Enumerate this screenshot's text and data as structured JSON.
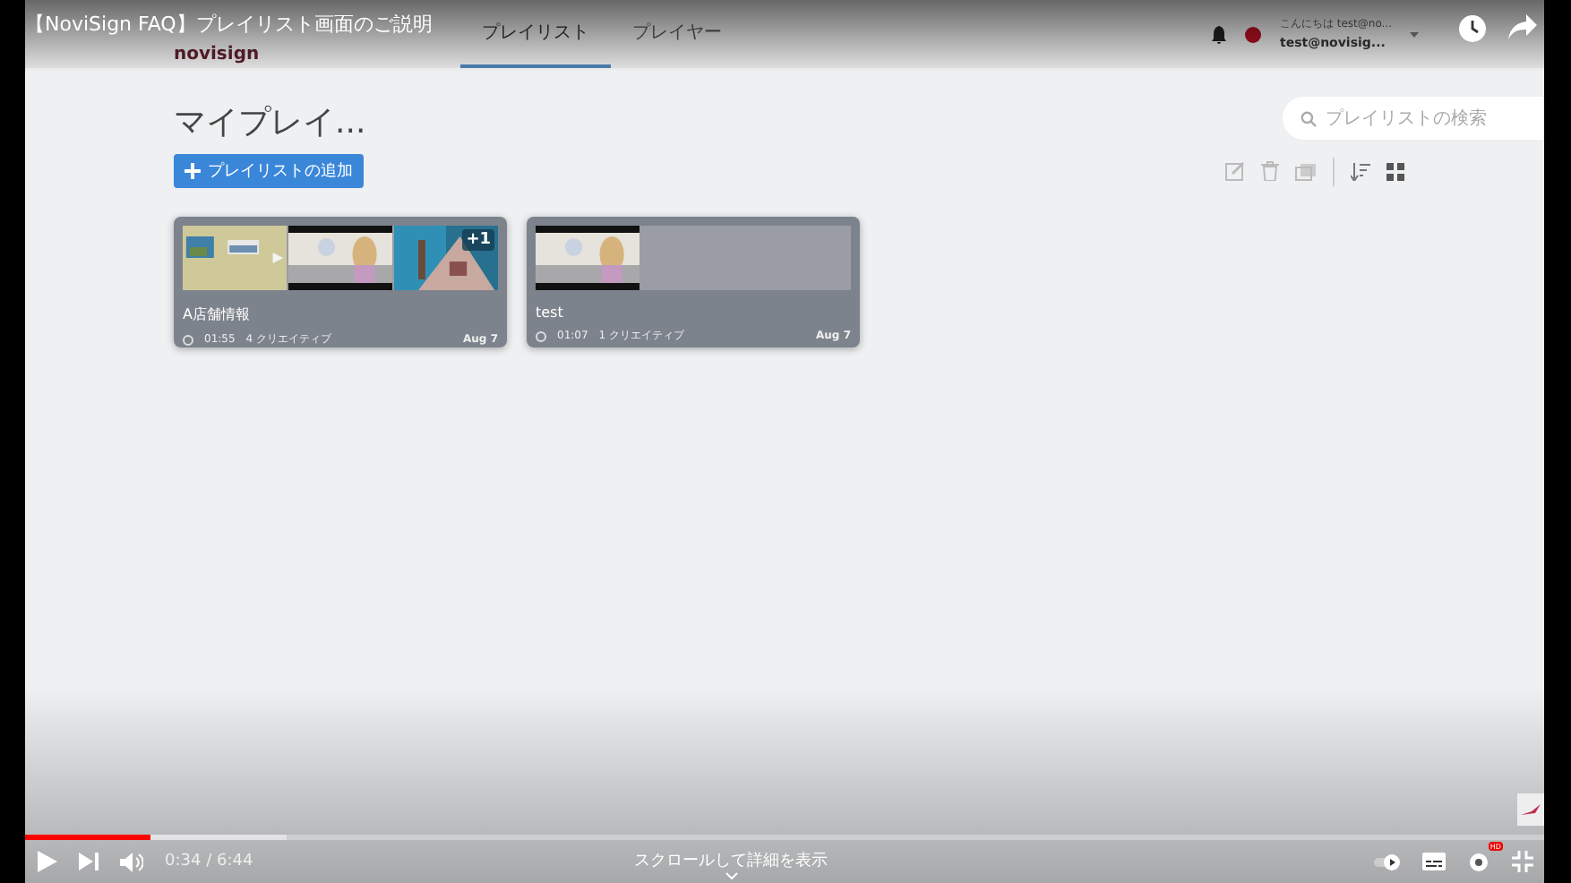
{
  "video": {
    "title": "【NoviSign FAQ】プレイリスト画面のご説明"
  },
  "app": {
    "logo": "novisign",
    "tabs": [
      {
        "label": "プレイリスト",
        "selected": true
      },
      {
        "label": "プレイヤー",
        "selected": false
      }
    ],
    "user": {
      "greeting": "こんにちは test@no...",
      "account": "test@novisig..."
    },
    "page_title": "マイプレイ...",
    "add_button": "プレイリストの追加",
    "search": {
      "placeholder": "プレイリストの検索"
    },
    "playlists": [
      {
        "name": "A店舗情報",
        "duration": "01:55",
        "creatives": "4 クリエイティブ",
        "date": "Aug 7",
        "thumbnails": [
          {
            "kind": "board"
          },
          {
            "kind": "person"
          },
          {
            "kind": "tower"
          }
        ],
        "more": "+1"
      },
      {
        "name": "test",
        "duration": "01:07",
        "creatives": "1 クリエイティブ",
        "date": "Aug 7",
        "thumbnails": [
          {
            "kind": "person"
          }
        ]
      }
    ]
  },
  "player": {
    "level": 0.082,
    "autoplay": true,
    "time": "0:34 / 6:44",
    "scroll_hint": "スクロールして詳細を表示",
    "quality_badge": "HD"
  }
}
